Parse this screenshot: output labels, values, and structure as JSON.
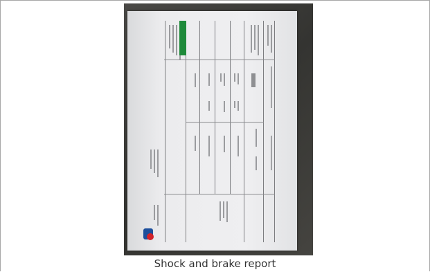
{
  "caption": "Shock and brake report",
  "colors": {
    "background_surface": "#3d3d3a",
    "paper": "#ececee",
    "accent_bar": "#1e8a3a",
    "logo_red": "#d2232a",
    "logo_blue": "#1d4f9c"
  },
  "image": {
    "icon": "document-photo"
  }
}
